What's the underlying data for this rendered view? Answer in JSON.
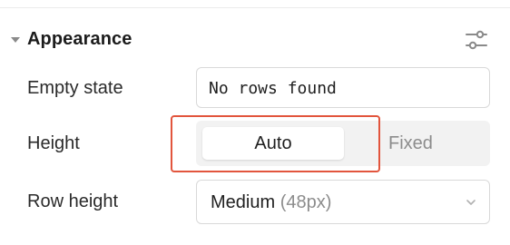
{
  "section": {
    "title": "Appearance",
    "settings_icon": "sliders-icon"
  },
  "rows": {
    "empty_state": {
      "label": "Empty state",
      "value": "No rows found"
    },
    "height": {
      "label": "Height",
      "options": [
        "Auto",
        "Fixed"
      ],
      "selected": "Auto"
    },
    "row_height": {
      "label": "Row height",
      "value": "Medium",
      "hint": "(48px)"
    }
  },
  "colors": {
    "highlight": "#e2553d",
    "segment_bg": "#f2f2f2"
  }
}
